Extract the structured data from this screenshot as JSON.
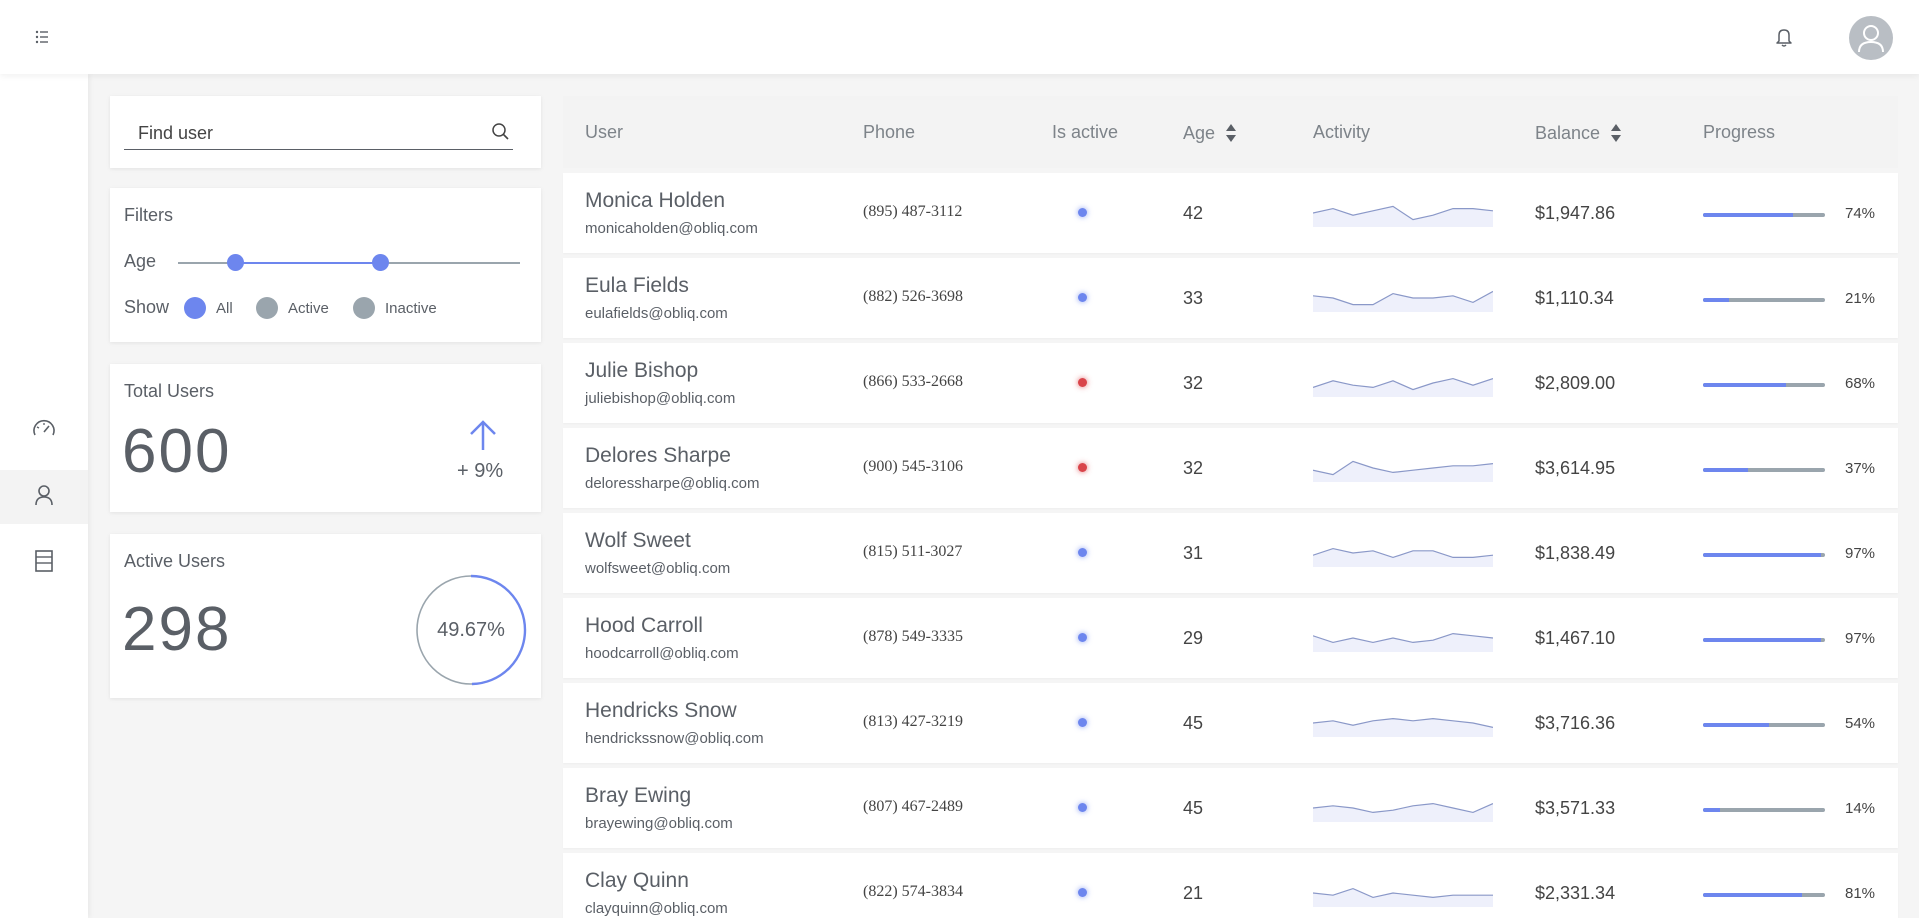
{
  "colors": {
    "accent": "#6d86ee",
    "muted": "#9aa5ad",
    "inactive": "#d9444a"
  },
  "topbar": {
    "menu_icon": "list-icon",
    "bell_icon": "bell-icon",
    "avatar_icon": "user-avatar-icon"
  },
  "sidebar": {
    "items": [
      {
        "icon": "speedometer-icon",
        "active": false
      },
      {
        "icon": "user-icon",
        "active": true
      },
      {
        "icon": "database-icon",
        "active": false
      }
    ]
  },
  "search": {
    "placeholder": "Find user",
    "value": ""
  },
  "filters": {
    "title": "Filters",
    "age_label": "Age",
    "age_range": [
      20,
      62
    ],
    "show_label": "Show",
    "options": [
      "All",
      "Active",
      "Inactive"
    ],
    "selected": "All"
  },
  "total_users": {
    "title": "Total Users",
    "value": "600",
    "delta": "+ 9%"
  },
  "active_users": {
    "title": "Active Users",
    "value": "298",
    "percent_label": "49.67%",
    "percent": 49.67
  },
  "table": {
    "columns": {
      "user": "User",
      "phone": "Phone",
      "is_active": "Is active",
      "age": "Age",
      "activity": "Activity",
      "balance": "Balance",
      "progress": "Progress"
    },
    "rows": [
      {
        "name": "Monica Holden",
        "email": "monicaholden@obliq.com",
        "phone": "(895) 487-3112",
        "active": true,
        "age": "42",
        "balance": "$1,947.86",
        "progress": 74,
        "progress_label": "74%",
        "activity": [
          5,
          7,
          4,
          6,
          8,
          2,
          4,
          7,
          7,
          6
        ]
      },
      {
        "name": "Eula Fields",
        "email": "eulafields@obliq.com",
        "phone": "(882) 526-3698",
        "active": true,
        "age": "33",
        "balance": "$1,110.34",
        "progress": 21,
        "progress_label": "21%",
        "activity": [
          6,
          5,
          2,
          2,
          7,
          5,
          5,
          6,
          3,
          8
        ]
      },
      {
        "name": "Julie Bishop",
        "email": "juliebishop@obliq.com",
        "phone": "(866) 533-2668",
        "active": false,
        "age": "32",
        "balance": "$2,809.00",
        "progress": 68,
        "progress_label": "68%",
        "activity": [
          3,
          6,
          4,
          3,
          6,
          2,
          5,
          7,
          4,
          7
        ]
      },
      {
        "name": "Delores Sharpe",
        "email": "deloressharpe@obliq.com",
        "phone": "(900) 545-3106",
        "active": false,
        "age": "32",
        "balance": "$3,614.95",
        "progress": 37,
        "progress_label": "37%",
        "activity": [
          4,
          2,
          8,
          5,
          3,
          4,
          5,
          6,
          6,
          7
        ]
      },
      {
        "name": "Wolf Sweet",
        "email": "wolfsweet@obliq.com",
        "phone": "(815) 511-3027",
        "active": true,
        "age": "31",
        "balance": "$1,838.49",
        "progress": 97,
        "progress_label": "97%",
        "activity": [
          4,
          7,
          5,
          6,
          3,
          6,
          6,
          3,
          3,
          4
        ]
      },
      {
        "name": "Hood Carroll",
        "email": "hoodcarroll@obliq.com",
        "phone": "(878) 549-3335",
        "active": true,
        "age": "29",
        "balance": "$1,467.10",
        "progress": 97,
        "progress_label": "97%",
        "activity": [
          6,
          3,
          5,
          3,
          5,
          3,
          4,
          7,
          6,
          5
        ]
      },
      {
        "name": "Hendricks Snow",
        "email": "hendrickssnow@obliq.com",
        "phone": "(813) 427-3219",
        "active": true,
        "age": "45",
        "balance": "$3,716.36",
        "progress": 54,
        "progress_label": "54%",
        "activity": [
          5,
          6,
          4,
          6,
          7,
          6,
          7,
          6,
          5,
          3
        ]
      },
      {
        "name": "Bray Ewing",
        "email": "brayewing@obliq.com",
        "phone": "(807) 467-2489",
        "active": true,
        "age": "45",
        "balance": "$3,571.33",
        "progress": 14,
        "progress_label": "14%",
        "activity": [
          5,
          6,
          5,
          3,
          4,
          6,
          7,
          5,
          3,
          7
        ]
      },
      {
        "name": "Clay Quinn",
        "email": "clayquinn@obliq.com",
        "phone": "(822) 574-3834",
        "active": true,
        "age": "21",
        "balance": "$2,331.34",
        "progress": 81,
        "progress_label": "81%",
        "activity": [
          5,
          4,
          7,
          3,
          5,
          4,
          3,
          4,
          4,
          4
        ]
      }
    ]
  }
}
